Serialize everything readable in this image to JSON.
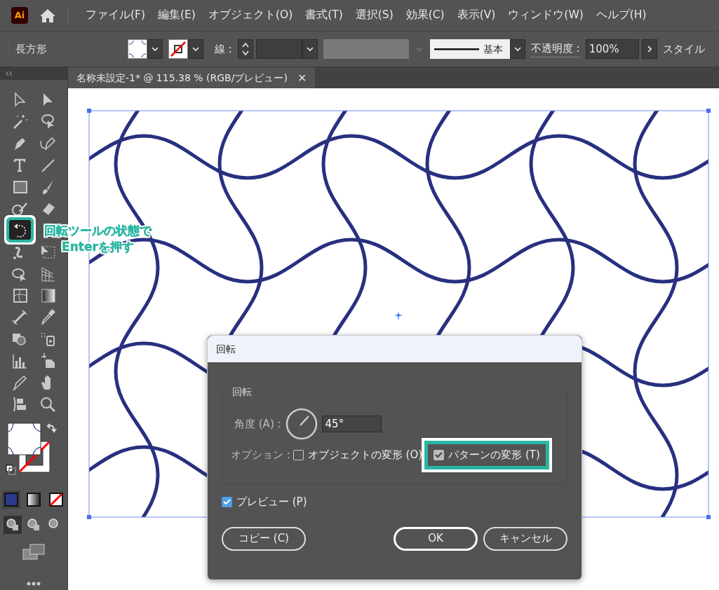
{
  "app": {
    "logo": "Ai"
  },
  "menu": [
    "ファイル(F)",
    "編集(E)",
    "オブジェクト(O)",
    "書式(T)",
    "選択(S)",
    "効果(C)",
    "表示(V)",
    "ウィンドウ(W)",
    "ヘルプ(H)"
  ],
  "control_bar": {
    "tool_name": "長方形",
    "stroke_label": "線 :",
    "stroke_style": "基本",
    "opacity_label": "不透明度 :",
    "opacity_value": "100%",
    "style_label": "スタイル"
  },
  "document_tab": {
    "title": "名称未設定-1* @ 115.38 % (RGB/プレビュー)",
    "close": "×",
    "selected": true
  },
  "rotate_tool": {
    "selected": true
  },
  "annotation": "回転ツールの状態で\nEnterを押す",
  "dialog": {
    "title": "回転",
    "group_label": "回転",
    "angle_label": "角度 (A) :",
    "angle_value": "45°",
    "options_label": "オプション :",
    "options": [
      {
        "label": "オブジェクトの変形 (O)",
        "checked": false,
        "highlighted": false
      },
      {
        "label": "パターンの変形 (T)",
        "checked": true,
        "highlighted": true
      }
    ],
    "preview": {
      "label": "プレビュー (P)",
      "checked": true
    },
    "buttons": [
      {
        "label": "コピー (C)",
        "default": false
      },
      {
        "label": "OK",
        "default": true
      },
      {
        "label": "キャンセル",
        "default": false
      }
    ]
  }
}
